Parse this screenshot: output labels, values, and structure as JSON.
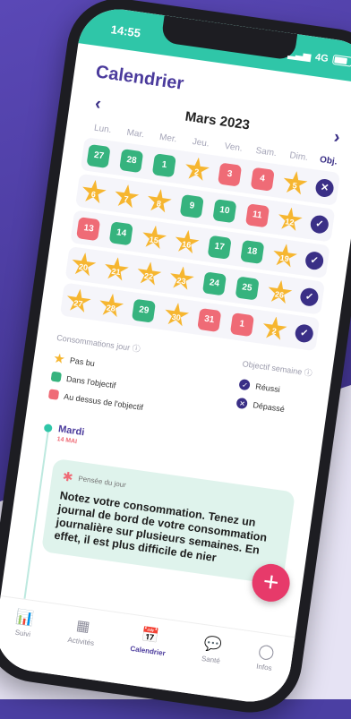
{
  "status": {
    "time": "14:55",
    "network": "4G"
  },
  "header": {
    "title": "Calendrier"
  },
  "calendar": {
    "month": "Mars 2023",
    "prev": "‹",
    "next": "›",
    "weekdays": [
      "Lun.",
      "Mar.",
      "Mer.",
      "Jeu.",
      "Ven.",
      "Sam.",
      "Dim."
    ],
    "obj_label": "Obj.",
    "weeks": [
      {
        "days": [
          {
            "n": "27",
            "t": "green"
          },
          {
            "n": "28",
            "t": "green"
          },
          {
            "n": "1",
            "t": "green"
          },
          {
            "n": "2",
            "t": "star"
          },
          {
            "n": "3",
            "t": "red"
          },
          {
            "n": "4",
            "t": "red"
          },
          {
            "n": "5",
            "t": "star"
          }
        ],
        "goal": "fail"
      },
      {
        "days": [
          {
            "n": "6",
            "t": "star"
          },
          {
            "n": "7",
            "t": "star"
          },
          {
            "n": "8",
            "t": "star"
          },
          {
            "n": "9",
            "t": "green"
          },
          {
            "n": "10",
            "t": "green"
          },
          {
            "n": "11",
            "t": "red"
          },
          {
            "n": "12",
            "t": "star"
          }
        ],
        "goal": "ok"
      },
      {
        "days": [
          {
            "n": "13",
            "t": "red"
          },
          {
            "n": "14",
            "t": "green"
          },
          {
            "n": "15",
            "t": "star"
          },
          {
            "n": "16",
            "t": "star"
          },
          {
            "n": "17",
            "t": "green"
          },
          {
            "n": "18",
            "t": "green"
          },
          {
            "n": "19",
            "t": "star"
          }
        ],
        "goal": "ok"
      },
      {
        "days": [
          {
            "n": "20",
            "t": "star"
          },
          {
            "n": "21",
            "t": "star"
          },
          {
            "n": "22",
            "t": "star"
          },
          {
            "n": "23",
            "t": "star"
          },
          {
            "n": "24",
            "t": "green"
          },
          {
            "n": "25",
            "t": "green"
          },
          {
            "n": "26",
            "t": "star"
          }
        ],
        "goal": "ok"
      },
      {
        "days": [
          {
            "n": "27",
            "t": "star"
          },
          {
            "n": "28",
            "t": "star"
          },
          {
            "n": "29",
            "t": "green"
          },
          {
            "n": "30",
            "t": "star"
          },
          {
            "n": "31",
            "t": "red"
          },
          {
            "n": "1",
            "t": "red"
          },
          {
            "n": "2",
            "t": "star"
          }
        ],
        "goal": "ok"
      }
    ]
  },
  "legend": {
    "consumption_title": "Consommations jour",
    "objective_title": "Objectif semaine",
    "items_left": [
      "Pas bu",
      "Dans l'objectif",
      "Au dessus de l'objectif"
    ],
    "items_right": [
      "Réussi",
      "Dépassé"
    ]
  },
  "feed": {
    "day": "Mardi",
    "date": "14 MAI",
    "card_label": "Pensée du jour",
    "card_text": "Notez votre consommation. Tenez un journal de bord de votre consommation journalière sur plusieurs semaines. En effet, il est plus difficile de nier"
  },
  "fab": "+",
  "tabs": [
    {
      "label": "Suivi",
      "icon": "chart-bars-icon",
      "glyph": "📊"
    },
    {
      "label": "Activités",
      "icon": "grid-icon",
      "glyph": "▦"
    },
    {
      "label": "Calendrier",
      "icon": "calendar-icon",
      "glyph": "📅"
    },
    {
      "label": "Santé",
      "icon": "chat-icon",
      "glyph": "💬"
    },
    {
      "label": "Infos",
      "icon": "user-icon",
      "glyph": "◯"
    }
  ],
  "colors": {
    "accent": "#4a3a9c",
    "teal": "#2fc6a8",
    "green": "#36b37e",
    "red": "#ef6b76",
    "star": "#f6b630",
    "fab": "#e73a6a"
  }
}
